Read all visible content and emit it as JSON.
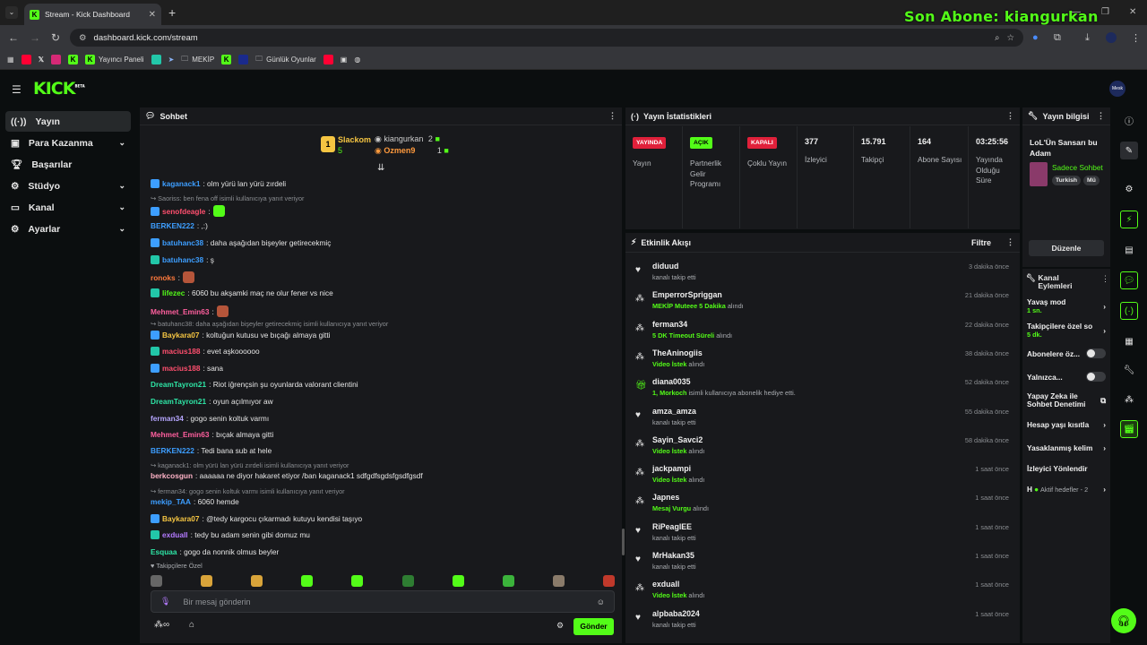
{
  "browser": {
    "tab_title": "Stream - Kick Dashboard",
    "new_tab": "+",
    "url": "dashboard.kick.com/stream",
    "overlay_text": "Son Abone: kiangurkan",
    "bookmarks": [
      "Yayıncı Paneli",
      "MEKİP",
      "Günlük Oyunlar"
    ]
  },
  "header": {
    "logo": "KICK",
    "logo_sup": "BETA",
    "avatar_label": "Mesk"
  },
  "sidebar": {
    "items": [
      {
        "label": "Yayın",
        "icon": "broadcast-icon"
      },
      {
        "label": "Para Kazanma",
        "icon": "money-icon"
      },
      {
        "label": "Başarılar",
        "icon": "trophy-icon"
      },
      {
        "label": "Stüdyo",
        "icon": "studio-icon"
      },
      {
        "label": "Kanal",
        "icon": "channel-icon"
      },
      {
        "label": "Ayarlar",
        "icon": "settings-icon"
      }
    ]
  },
  "chat": {
    "title": "Sohbet",
    "pinned": {
      "top_user": "Slackom",
      "top_count": "5",
      "rank": "1",
      "second_user": "kiangurkan",
      "second_count": "2",
      "third_user": "Ozmen9",
      "third_count": "1"
    },
    "messages": [
      {
        "type": "msg",
        "user": "kaganack1",
        "color": "#3d9eff",
        "text": ": olm yürü lan yürü zırdeli"
      },
      {
        "type": "reply",
        "text": "↪ Saoriss: ben fena off isimli kullanıcıya yanıt veriyor"
      },
      {
        "type": "msg",
        "user": "senofdeagle",
        "color": "#ff4f6e",
        "text": ":"
      },
      {
        "type": "msg",
        "user": "BERKEN222",
        "color": "#3d9eff",
        "text": ": ,:)"
      },
      {
        "type": "msg",
        "user": "batuhanc38",
        "color": "#3d9eff",
        "text": ": daha aşağıdan bişeyler getirecekmiç"
      },
      {
        "type": "msg",
        "user": "batuhanc38",
        "color": "#3d9eff",
        "text": ": ş"
      },
      {
        "type": "msg",
        "user": "ronoks",
        "color": "#ff7a3d",
        "text": ":"
      },
      {
        "type": "msg",
        "user": "lifezec",
        "color": "#53fc18",
        "text": ": 6060 bu akşamki maç ne olur fener vs nice"
      },
      {
        "type": "msg",
        "user": "Mehmet_Emin63",
        "color": "#ff5f9e",
        "text": ":"
      },
      {
        "type": "reply",
        "text": "↪ batuhanc38: daha aşağıdan bişeyler getirecekmiç isimli kullanıcıya yanıt veriyor"
      },
      {
        "type": "msg",
        "user": "Baykara07",
        "color": "#f5c542",
        "text": ": koltuğun kutusu ve bıçağı almaya gitti"
      },
      {
        "type": "msg",
        "user": "macius188",
        "color": "#ff4f6e",
        "text": ": evet aşkoooooo"
      },
      {
        "type": "msg",
        "user": "macius188",
        "color": "#ff4f6e",
        "text": ": sana"
      },
      {
        "type": "msg",
        "user": "DreamTayron21",
        "color": "#2ee6a6",
        "text": ": Riot iğrençsin şu oyunlarda valorant clientini"
      },
      {
        "type": "msg",
        "user": "DreamTayron21",
        "color": "#2ee6a6",
        "text": ": oyun açılmıyor aw"
      },
      {
        "type": "msg",
        "user": "ferman34",
        "color": "#b6a6ff",
        "text": ": gogo senin koltuk varmı"
      },
      {
        "type": "msg",
        "user": "Mehmet_Emin63",
        "color": "#ff5f9e",
        "text": ": bıçak almaya gitti"
      },
      {
        "type": "msg",
        "user": "BERKEN222",
        "color": "#3d9eff",
        "text": ": Tedi bana sub at hele"
      },
      {
        "type": "reply",
        "text": "↪ kaganack1: olm yürü lan yürü zırdeli isimli kullanıcıya yanıt veriyor"
      },
      {
        "type": "msg",
        "user": "berkcosgun",
        "color": "#ffb3c7",
        "text": ": aaaaaa ne diyor hakaret etiyor /ban kaganack1 sdfgdfsgdsfgsdfgsdf"
      },
      {
        "type": "reply",
        "text": "↪ ferman34: gogo senin koltuk varmı isimli kullanıcıya yanıt veriyor"
      },
      {
        "type": "msg",
        "user": "mekip_TAA",
        "color": "#3d9eff",
        "text": ": 6060 hemde"
      },
      {
        "type": "msg",
        "user": "Baykara07",
        "color": "#f5c542",
        "text": ": @tedy kargocu çıkarmadı kutuyu kendisi taşıyo"
      },
      {
        "type": "msg",
        "user": "exduall",
        "color": "#b47aff",
        "text": ": tedy bu adam senin gibi domuz mu"
      },
      {
        "type": "msg",
        "user": "Esquaa",
        "color": "#2ee6a6",
        "text": ": gogo da nonnik olmus beyler"
      }
    ],
    "followers_only": "Takipçilere Özel",
    "input_placeholder": "Bir mesaj gönderin",
    "send_label": "Gönder"
  },
  "stats": {
    "title": "Yayın İstatistikleri",
    "cols": [
      {
        "pill": "YAYINDA",
        "pill_bg": "#e0203a",
        "pill_fg": "#ffffff",
        "label": "Yayın"
      },
      {
        "pill": "AÇIK",
        "pill_bg": "#53fc18",
        "pill_fg": "#000000",
        "label": "Partnerlik Gelir Programı"
      },
      {
        "pill": "KAPALI",
        "pill_bg": "#e0203a",
        "pill_fg": "#ffffff",
        "label": "Çoklu Yayın"
      },
      {
        "num": "377",
        "label": "İzleyici"
      },
      {
        "num": "15.791",
        "label": "Takipçi"
      },
      {
        "num": "164",
        "label": "Abone Sayısı"
      },
      {
        "num": "03:25:56",
        "label": "Yayında Olduğu Süre"
      }
    ]
  },
  "activity": {
    "title": "Etkinlik Akışı",
    "filter": "Filtre",
    "items": [
      {
        "icon": "heart",
        "name": "diduud",
        "pre": "",
        "hl": "",
        "post": "kanalı takip etti",
        "time": "3 dakika önce"
      },
      {
        "icon": "redeem",
        "name": "EmperrorSpriggan",
        "pre": "",
        "hl": "MEKİP Muteee 5 Dakika",
        "post": " alındı",
        "time": "21 dakika önce"
      },
      {
        "icon": "redeem",
        "name": "ferman34",
        "pre": "",
        "hl": "5 DK Timeout Süreli",
        "post": " alındı",
        "time": "22 dakika önce"
      },
      {
        "icon": "redeem",
        "name": "TheAninogiis",
        "pre": "",
        "hl": "Video İstek",
        "post": " alındı",
        "time": "38 dakika önce"
      },
      {
        "icon": "gift",
        "name": "diana0035",
        "pre": "",
        "hl": "1, Morkoch",
        "post": " isimli kullanıcıya abonelik hediye etti.",
        "time": "52 dakika önce"
      },
      {
        "icon": "heart",
        "name": "amza_amza",
        "pre": "",
        "hl": "",
        "post": "kanalı takip etti",
        "time": "55 dakika önce"
      },
      {
        "icon": "redeem",
        "name": "Sayin_Savci2",
        "pre": "",
        "hl": "Video İstek",
        "post": " alındı",
        "time": "58 dakika önce"
      },
      {
        "icon": "redeem",
        "name": "jackpampi",
        "pre": "",
        "hl": "Video İstek",
        "post": " alındı",
        "time": "1 saat önce"
      },
      {
        "icon": "redeem",
        "name": "Japnes",
        "pre": "",
        "hl": "Mesaj Vurgu",
        "post": " alındı",
        "time": "1 saat önce"
      },
      {
        "icon": "heart",
        "name": "RiPeaglEE",
        "pre": "",
        "hl": "",
        "post": "kanalı takip etti",
        "time": "1 saat önce"
      },
      {
        "icon": "heart",
        "name": "MrHakan35",
        "pre": "",
        "hl": "",
        "post": "kanalı takip etti",
        "time": "1 saat önce"
      },
      {
        "icon": "redeem",
        "name": "exduall",
        "pre": "",
        "hl": "Video İstek",
        "post": " alındı",
        "time": "1 saat önce"
      },
      {
        "icon": "heart",
        "name": "alpbaba2024",
        "pre": "",
        "hl": "",
        "post": "kanalı takip etti",
        "time": "1 saat önce"
      }
    ]
  },
  "info": {
    "title": "Yayın bilgisi",
    "stream_title": "LoL'Ün Sansarı bu Adam",
    "category": "Sadece Sohbet",
    "tags": [
      "Turkish",
      "Mü"
    ],
    "edit_label": "Düzenle"
  },
  "actions": {
    "title": "Kanal Eylemleri",
    "slow_mode": "Yavaş mod",
    "slow_value": "1 sn.",
    "followers_mode": "Takipçilere özel so",
    "followers_value": "5 dk.",
    "subs_only": "Abonelere öz...",
    "alone": "Yalnızca...",
    "ai_moderation": "Yapay Zeka ile Sohbet Denetimi",
    "account_age": "Hesap yaşı kısıtla",
    "banned_words": "Yasaklanmış kelim",
    "viewer_redirect": "İzleyici Yönlendir",
    "goals_prefix": "H",
    "goals": "Aktif hedefler - 2"
  }
}
